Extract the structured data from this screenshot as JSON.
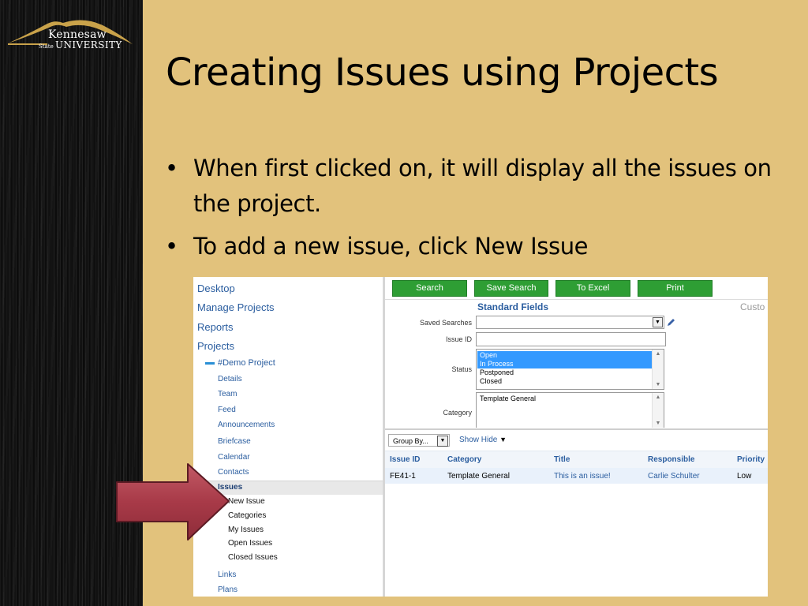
{
  "logo": {
    "line1": "Kennesaw",
    "state": "State",
    "line2": "UNIVERSITY"
  },
  "slide": {
    "title": "Creating Issues using Projects",
    "bullets": [
      "When first clicked on, it will display all the issues on the project.",
      "To add a new issue, click New Issue"
    ],
    "bullet_char": "•"
  },
  "colors": {
    "slide_bg": "#e2c27c",
    "strip_bg": "#121212",
    "button_green": "#2e9e34",
    "link_blue": "#2a5d9f",
    "arrow_red": "#a83a48"
  },
  "screenshot": {
    "nav": {
      "top_items": [
        "Desktop",
        "Manage Projects",
        "Reports",
        "Projects"
      ],
      "project": "#Demo Project",
      "project_items": [
        "Details",
        "Team",
        "Feed",
        "Announcements",
        "Briefcase",
        "Calendar",
        "Contacts"
      ],
      "active_item": "Issues",
      "issue_items": [
        "New Issue",
        "Categories",
        "My Issues",
        "Open Issues",
        "Closed Issues"
      ],
      "after_items": [
        "Links",
        "Plans"
      ]
    },
    "buttons": [
      "Search",
      "Save Search",
      "To Excel",
      "Print"
    ],
    "standard_fields": "Standard Fields",
    "custom_tab": "Custo",
    "fields": {
      "saved_searches": "Saved Searches",
      "issue_id": "Issue ID",
      "status": "Status",
      "status_options": [
        {
          "label": "Open",
          "selected": true
        },
        {
          "label": "In Process",
          "selected": true
        },
        {
          "label": "Postponed",
          "selected": false
        },
        {
          "label": "Closed",
          "selected": false
        }
      ],
      "category": "Category",
      "category_options": [
        "Template General"
      ]
    },
    "group_by": "Group By...",
    "show_hide": "Show Hide",
    "table": {
      "columns": [
        "Issue ID",
        "Category",
        "Title",
        "Responsible",
        "Priority"
      ],
      "rows": [
        {
          "issue_id": "FE41-1",
          "category": "Template General",
          "title": "This is an issue!",
          "responsible": "Carlie Schulter",
          "priority": "Low"
        }
      ]
    }
  }
}
